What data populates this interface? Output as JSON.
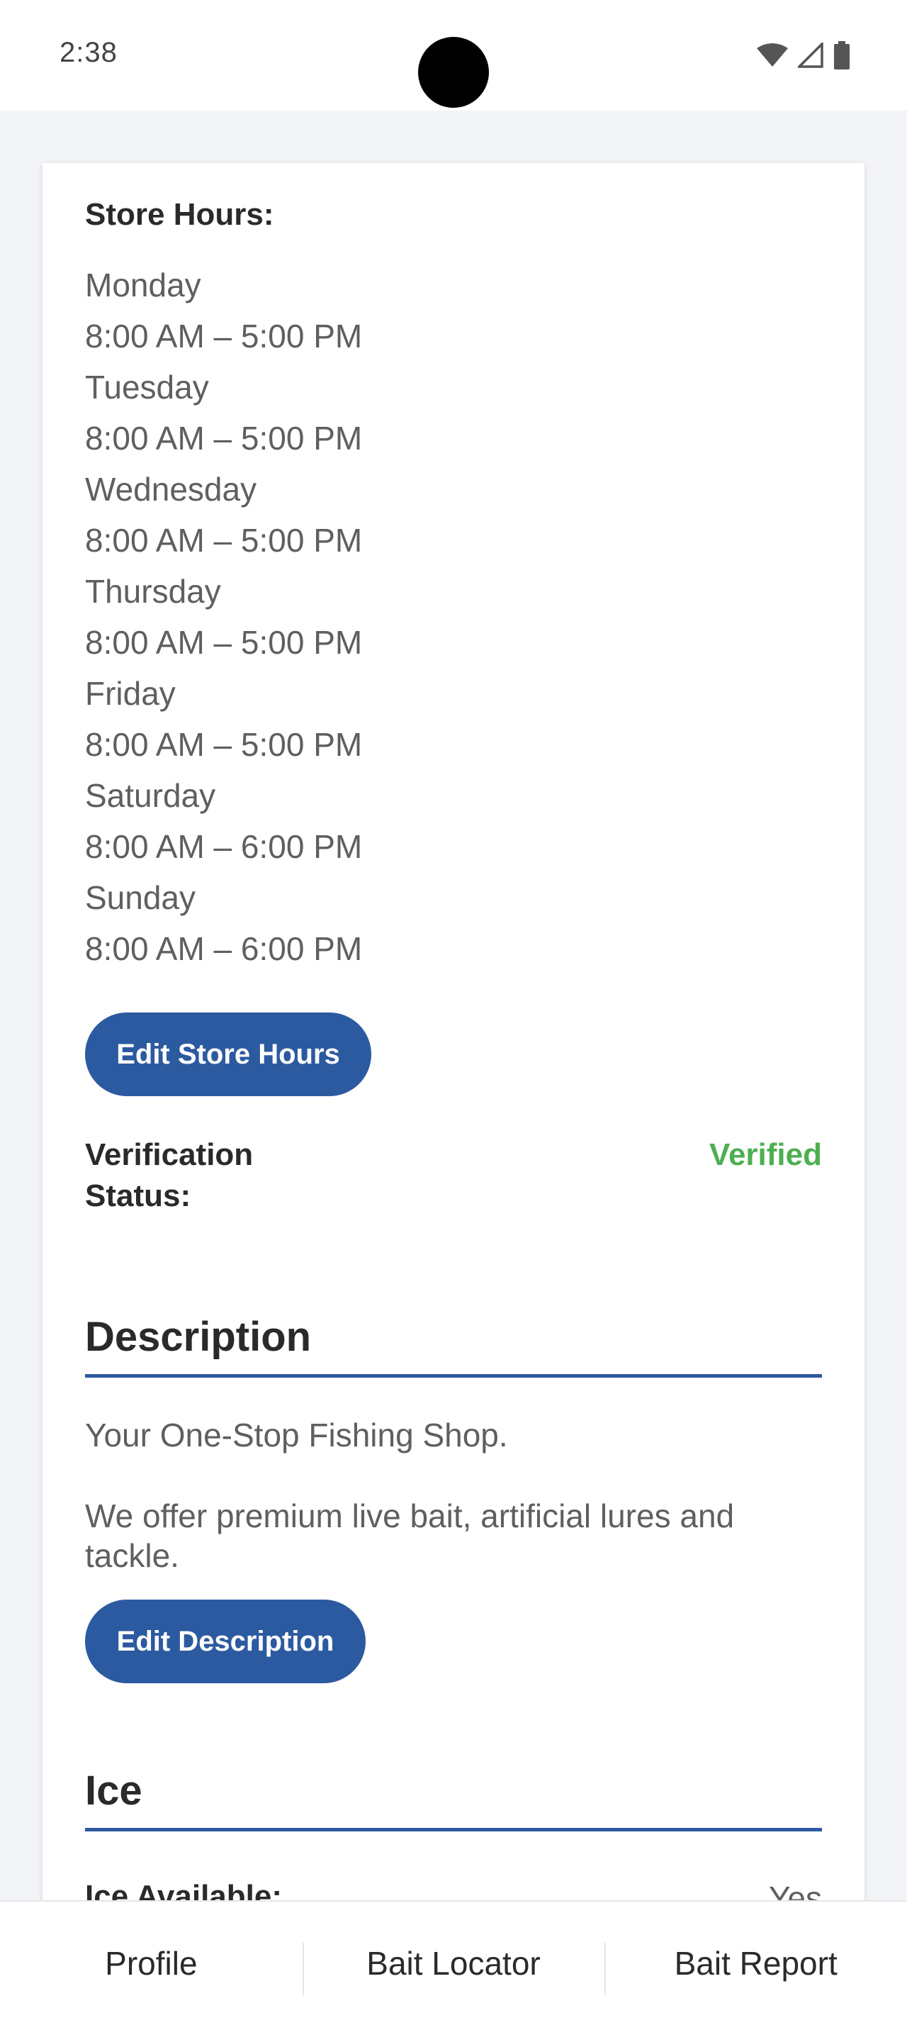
{
  "status_bar": {
    "time": "2:38"
  },
  "store_hours": {
    "label": "Store Hours:",
    "lines": [
      "Monday",
      "8:00 AM – 5:00 PM",
      "Tuesday",
      "8:00 AM – 5:00 PM",
      "Wednesday",
      "8:00 AM – 5:00 PM",
      "Thursday",
      "8:00 AM – 5:00 PM",
      "Friday",
      "8:00 AM – 5:00 PM",
      "Saturday",
      "8:00 AM – 6:00 PM",
      "Sunday",
      "8:00 AM – 6:00 PM"
    ],
    "edit_button": "Edit Store Hours"
  },
  "verification": {
    "label": "Verification Status:",
    "value": "Verified",
    "value_color": "#4caf50"
  },
  "description": {
    "title": "Description",
    "line1": "Your One-Stop Fishing Shop.",
    "line2": "We offer premium live bait, artificial lures and tackle.",
    "edit_button": "Edit Description"
  },
  "ice": {
    "title": "Ice",
    "available_label": "Ice Available:",
    "available_value": "Yes"
  },
  "bottom_nav": {
    "items": [
      "Profile",
      "Bait Locator",
      "Bait Report"
    ]
  },
  "colors": {
    "accent": "#2c5aa0",
    "verified": "#4caf50",
    "background": "#f3f4f8"
  }
}
